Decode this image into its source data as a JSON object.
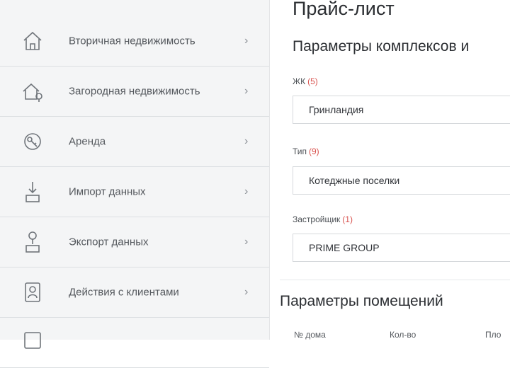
{
  "sidebar": {
    "items": [
      {
        "label": "Вторичная недвижимость",
        "icon": "house-icon"
      },
      {
        "label": "Загородная недвижимость",
        "icon": "country-house-icon"
      },
      {
        "label": "Аренда",
        "icon": "keys-icon"
      },
      {
        "label": "Импорт данных",
        "icon": "import-icon"
      },
      {
        "label": "Экспорт данных",
        "icon": "export-icon"
      },
      {
        "label": "Действия с клиентами",
        "icon": "client-actions-icon"
      },
      {
        "label": "",
        "icon": "item-icon"
      }
    ],
    "chevron": "›"
  },
  "main": {
    "title": "Прайс-лист",
    "complex_section_title": "Параметры комплексов и",
    "fields": [
      {
        "label": "ЖК",
        "count": "(5)",
        "value": "Гринландия"
      },
      {
        "label": "Тип",
        "count": "(9)",
        "value": "Котеджные поселки"
      },
      {
        "label": "Застройщик",
        "count": "(1)",
        "value": "PRIME GROUP"
      }
    ],
    "rooms_section_title": "Параметры помещений",
    "rooms_columns": [
      "№ дома",
      "Кол-во",
      "Пло"
    ]
  }
}
